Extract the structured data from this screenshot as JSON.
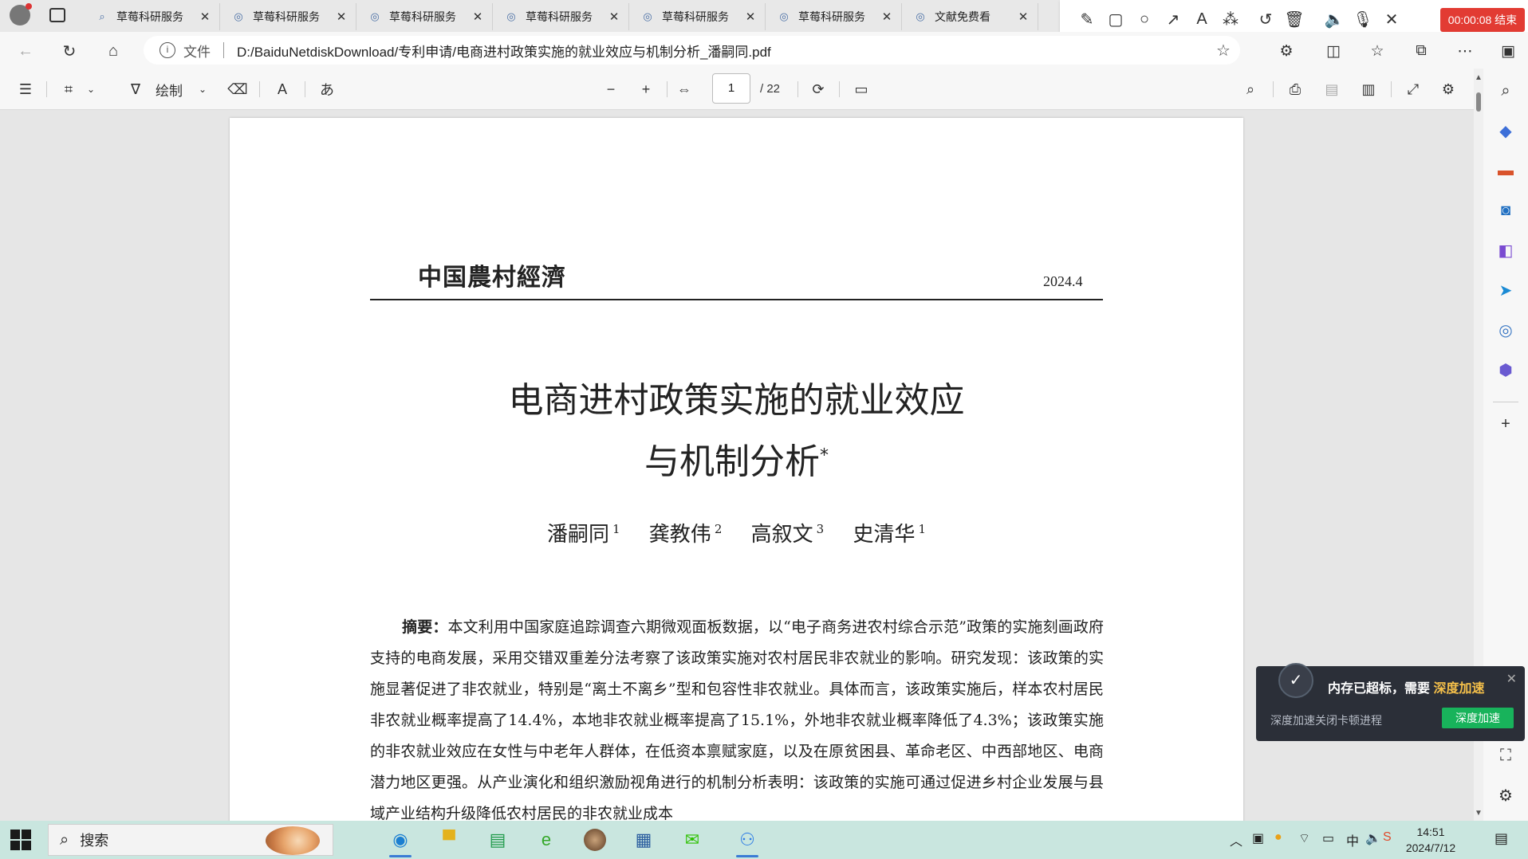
{
  "tabs": [
    {
      "title": "草莓科研服务",
      "icon": "search-icon"
    },
    {
      "title": "草莓科研服务",
      "icon": "page-icon"
    },
    {
      "title": "草莓科研服务",
      "icon": "page-icon"
    },
    {
      "title": "草莓科研服务",
      "icon": "page-icon"
    },
    {
      "title": "草莓科研服务",
      "icon": "page-icon"
    },
    {
      "title": "草莓科研服务",
      "icon": "page-icon"
    },
    {
      "title": "文献免费看",
      "icon": "page-icon"
    }
  ],
  "annotation_toolbar": {
    "timer": "00:00:08 结束"
  },
  "address": {
    "label": "文件",
    "url": "D:/BaiduNetdiskDownload/专利申请/电商进村政策实施的就业效应与机制分析_潘嗣同.pdf"
  },
  "pdf_toolbar": {
    "draw_label": "绘制",
    "page_current": "1",
    "page_total": "/ 22"
  },
  "document": {
    "journal": "中国農村經濟",
    "issue": "2024.4",
    "title_line1": "电商进村政策实施的就业效应",
    "title_line2": "与机制分析",
    "title_mark": "*",
    "authors": [
      {
        "name": "潘嗣同",
        "aff": "1"
      },
      {
        "name": "龚教伟",
        "aff": "2"
      },
      {
        "name": "高叙文",
        "aff": "3"
      },
      {
        "name": "史清华",
        "aff": "1"
      }
    ],
    "abstract_lead": "摘要：",
    "abstract_text": "本文利用中国家庭追踪调查六期微观面板数据，以“电子商务进农村综合示范”政策的实施刻画政府支持的电商发展，采用交错双重差分法考察了该政策实施对农村居民非农就业的影响。研究发现：该政策的实施显著促进了非农就业，特别是“离土不离乡”型和包容性非农就业。具体而言，该政策实施后，样本农村居民非农就业概率提高了14.4%，本地非农就业概率提高了15.1%，外地非农就业概率降低了4.3%；该政策实施的非农就业效应在女性与中老年人群体，在低资本禀赋家庭，以及在原贫困县、革命老区、中西部地区、电商潜力地区更强。从产业演化和组织激励视角进行的机制分析表明：该政策的实施可通过促进乡村企业发展与县域产业结构升级降低农村居民的非农就业成本"
  },
  "notification": {
    "message": "内存已超标，需要",
    "highlight": "深度加速",
    "sub": "深度加速关闭卡顿进程",
    "button": "深度加速"
  },
  "taskbar": {
    "search_label": "搜索",
    "time": "14:51",
    "date": "2024/7/12",
    "ime": "中"
  },
  "colors": {
    "record": "#e23b33",
    "notify_bg": "#2b2f38",
    "notify_button": "#18b35b",
    "taskbar": "#c9e6df"
  }
}
